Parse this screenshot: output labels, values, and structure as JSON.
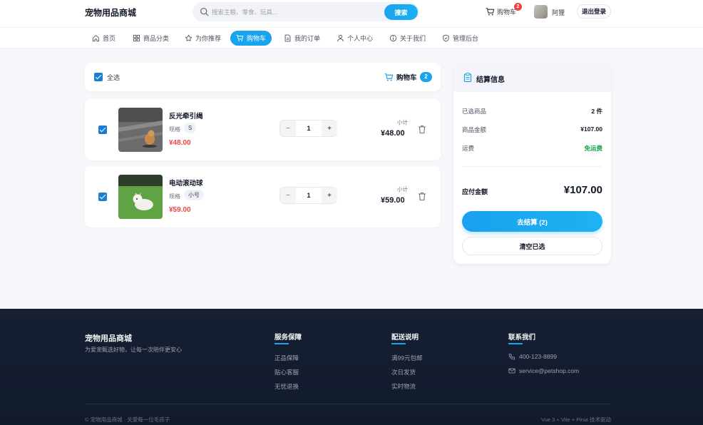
{
  "header": {
    "brand": "宠物用品商城",
    "search_placeholder": "搜索主粮、零食、玩具...",
    "search_button": "搜索",
    "cart_label": "购物车",
    "cart_badge": "2",
    "username": "阿狸",
    "logout": "退出登录"
  },
  "nav": {
    "items": [
      {
        "label": "首页",
        "icon": "home-icon"
      },
      {
        "label": "商品分类",
        "icon": "grid-icon"
      },
      {
        "label": "为你推荐",
        "icon": "star-icon"
      },
      {
        "label": "购物车",
        "icon": "cart-icon",
        "active": true
      },
      {
        "label": "我的订单",
        "icon": "document-icon"
      },
      {
        "label": "个人中心",
        "icon": "user-icon"
      },
      {
        "label": "关于我们",
        "icon": "info-icon"
      },
      {
        "label": "管理后台",
        "icon": "shield-icon"
      }
    ]
  },
  "cart": {
    "select_all": "全选",
    "title": "购物车",
    "count": "2",
    "items": [
      {
        "name": "反光牵引绳",
        "spec_label": "规格",
        "spec": "S",
        "price": "¥48.00",
        "qty": "1",
        "subtotal_label": "小计",
        "subtotal": "¥48.00",
        "checked": true
      },
      {
        "name": "电动滚动球",
        "spec_label": "规格",
        "spec": "小号",
        "price": "¥59.00",
        "qty": "1",
        "subtotal_label": "小计",
        "subtotal": "¥59.00",
        "checked": true
      }
    ]
  },
  "summary": {
    "title": "结算信息",
    "rows": [
      {
        "label": "已选商品",
        "value": "2 件"
      },
      {
        "label": "商品金额",
        "value": "¥107.00"
      },
      {
        "label": "运费",
        "value": "免运费"
      }
    ],
    "pay_label": "应付金额",
    "pay_value": "¥107.00",
    "checkout": "去结算 (2)",
    "clear": "清空已选"
  },
  "footer": {
    "brand": "宠物用品商城",
    "tagline": "为爱宠甄选好物，让每一次陪伴更安心",
    "service_title": "服务保障",
    "service_links": [
      "正品保障",
      "贴心客服",
      "无忧退换"
    ],
    "delivery_title": "配送说明",
    "delivery_links": [
      "满99元包邮",
      "次日发货",
      "实时物流"
    ],
    "contact_title": "联系我们",
    "phone": "400-123-8899",
    "email": "service@petshop.com",
    "copyright": "© 宠物用品商城 · 关爱每一位毛孩子",
    "tech": "Vue 3 + Vite + Pinia 技术驱动"
  },
  "colors": {
    "accent": "#18a4ee",
    "price": "#ef4444",
    "free_shipping": "#16a34a",
    "footer_bg": "#172033"
  }
}
